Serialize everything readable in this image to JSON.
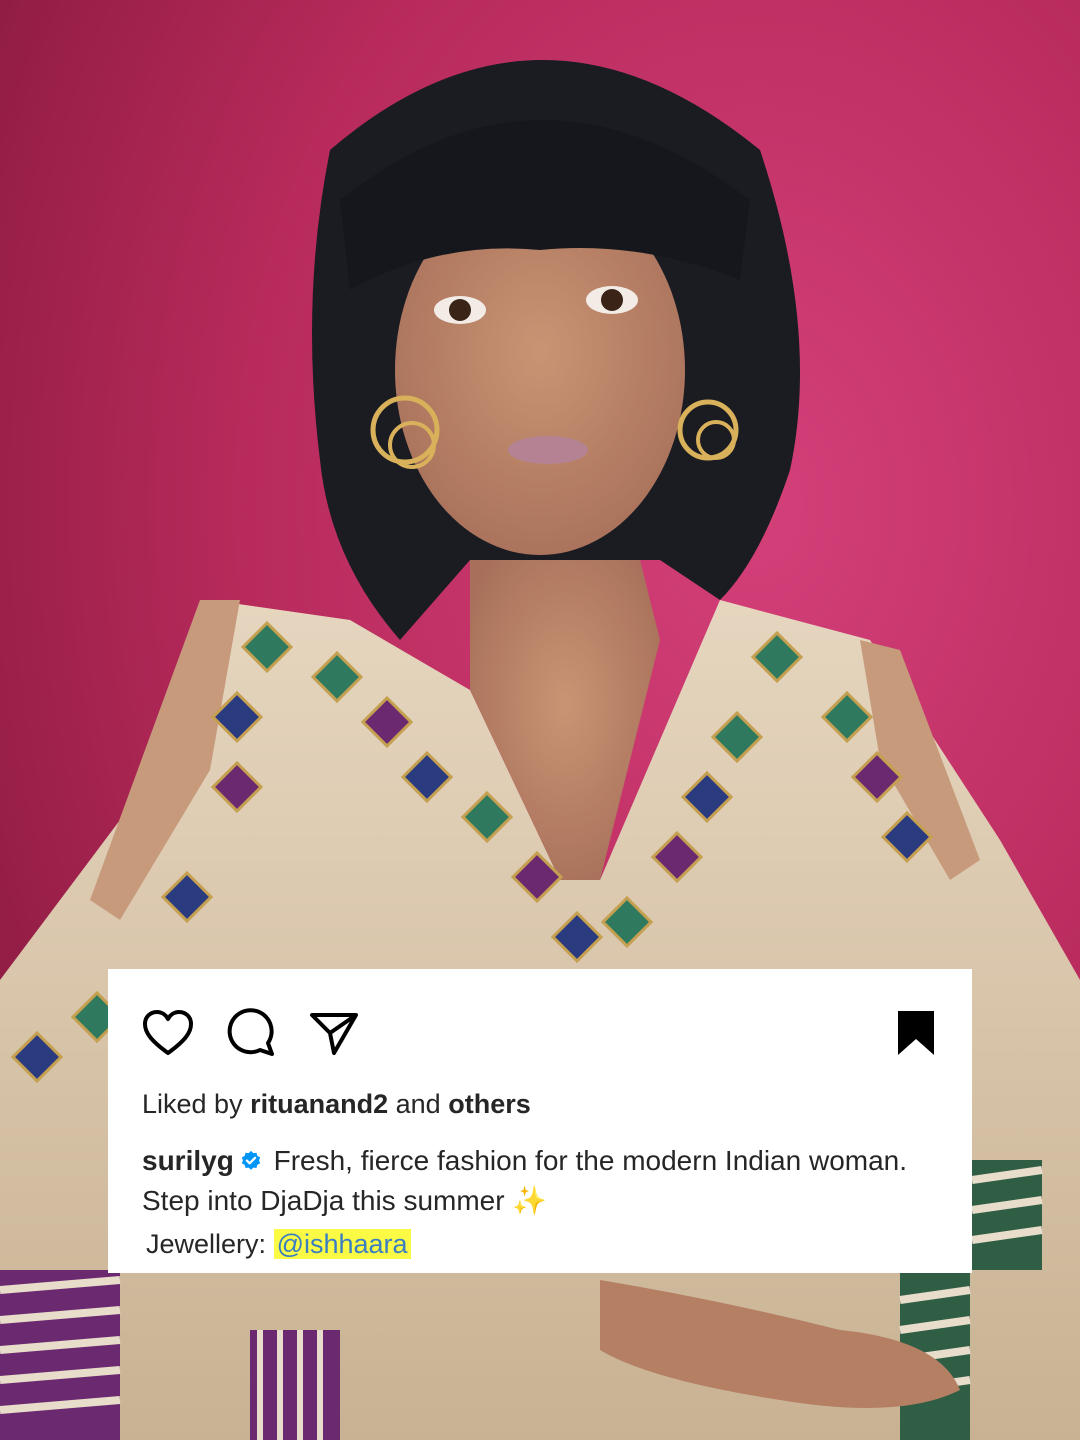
{
  "post": {
    "likes": {
      "prefix": "Liked by",
      "user": "rituanand2",
      "conjunction": "and",
      "others": "others"
    },
    "caption": {
      "username": "surilyg",
      "text": "Fresh, fierce fashion for the modern Indian woman. Step into DjaDja this summer",
      "emoji": "✨"
    },
    "credit": {
      "label": "Jewellery:",
      "mention": "@ishhaara"
    },
    "icons": {
      "like": "heart-icon",
      "comment": "comment-icon",
      "share": "send-icon",
      "save": "bookmark-icon",
      "verified": "verified-badge-icon"
    }
  },
  "colors": {
    "background": "#b8285a",
    "card": "#ffffff",
    "text": "#262626",
    "verified": "#0095f6",
    "highlight": "#fbfb45",
    "mention": "#3b7ec2"
  }
}
